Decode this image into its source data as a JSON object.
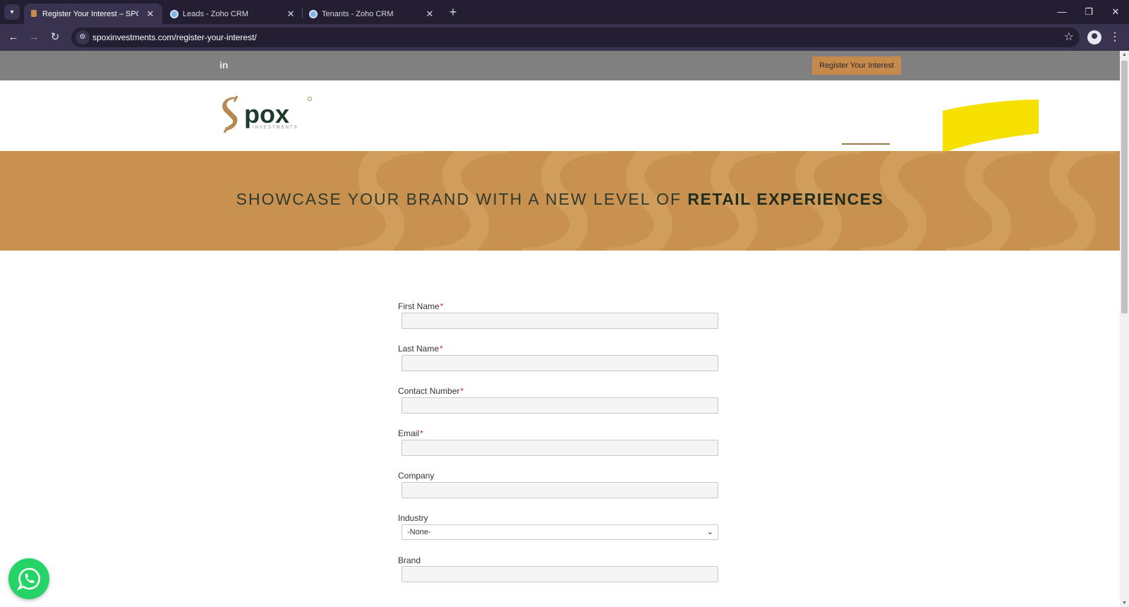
{
  "browser": {
    "tabs": [
      {
        "title": "Register Your Interest – SPOX In",
        "active": true,
        "favicon": "spox-icon"
      },
      {
        "title": "Leads - Zoho CRM",
        "active": false,
        "favicon": "zoho-icon"
      },
      {
        "title": "Tenants - Zoho CRM",
        "active": false,
        "favicon": "zoho-icon"
      }
    ],
    "url": "spoxinvestments.com/register-your-interest/"
  },
  "site": {
    "register_button": "Register Your Interest",
    "social_icon": "linkedin-icon",
    "logo_main": "pox",
    "logo_sub": "INVESTMENTS",
    "hero_light": "SHOWCASE YOUR BRAND WITH A NEW LEVEL OF",
    "hero_bold": "RETAIL EXPERIENCES"
  },
  "form": {
    "fields": [
      {
        "label": "First Name",
        "required_mark": "*",
        "type": "text",
        "value": ""
      },
      {
        "label": "Last Name",
        "required_mark": "*",
        "type": "text",
        "value": ""
      },
      {
        "label": "Contact Number",
        "required_mark": "*",
        "type": "text",
        "value": ""
      },
      {
        "label": "Email",
        "required_mark": "*",
        "type": "text",
        "value": ""
      },
      {
        "label": "Company",
        "required_mark": "",
        "type": "text",
        "value": ""
      },
      {
        "label": "Industry",
        "required_mark": "",
        "type": "select",
        "value": "-None-"
      },
      {
        "label": "Brand",
        "required_mark": "",
        "type": "text",
        "value": ""
      }
    ]
  },
  "colors": {
    "brand_gold": "#c8914f",
    "brand_green": "#1e3a2a",
    "topbar_gray": "#808080",
    "whatsapp_green": "#25d366",
    "highlight_yellow": "#f5e000"
  }
}
